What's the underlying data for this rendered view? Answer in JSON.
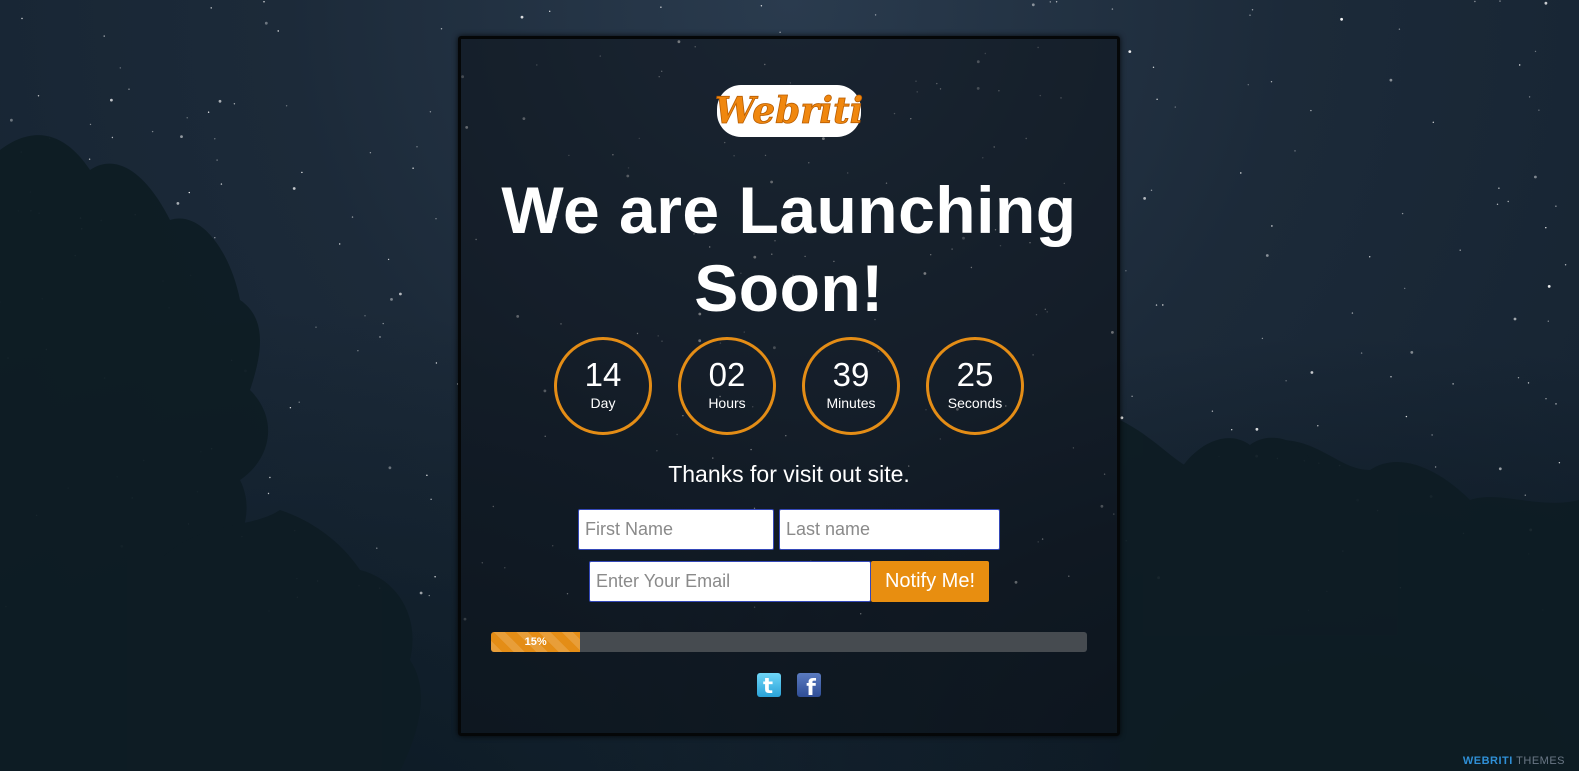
{
  "logo": {
    "text": "Webriti"
  },
  "headline": {
    "line1": "We are Launching",
    "line2": "Soon!"
  },
  "countdown": [
    {
      "value": "14",
      "label": "Day"
    },
    {
      "value": "02",
      "label": "Hours"
    },
    {
      "value": "39",
      "label": "Minutes"
    },
    {
      "value": "25",
      "label": "Seconds"
    }
  ],
  "tagline": "Thanks for visit out site.",
  "form": {
    "first_name_placeholder": "First Name",
    "last_name_placeholder": "Last name",
    "email_placeholder": "Enter Your Email",
    "submit_label": "Notify Me!"
  },
  "progress": {
    "percent": 15,
    "label": "15%"
  },
  "social": [
    {
      "name": "twitter",
      "icon": "twitter-icon",
      "glyph": "t"
    },
    {
      "name": "facebook",
      "icon": "facebook-icon",
      "glyph": "f"
    }
  ],
  "footer_brand": {
    "part1": "WEBRITI",
    "part2": " THEMES"
  },
  "colors": {
    "accent": "#e48d16",
    "button": "#e88e10",
    "background": "#1c2a39"
  }
}
